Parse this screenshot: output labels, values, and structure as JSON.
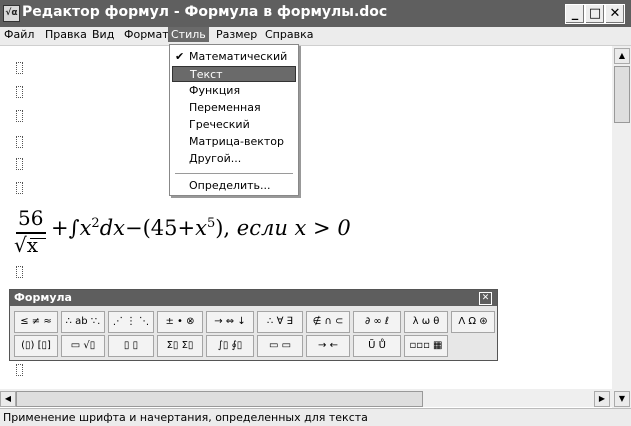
{
  "window": {
    "title": "Редактор формул - Формула в формулы.doc",
    "icon": "formula-editor-app-icon",
    "buttons": {
      "minimize": "_",
      "maximize": "□",
      "close": "✕"
    }
  },
  "menubar": {
    "items": [
      "Файл",
      "Правка",
      "Вид",
      "Формат",
      "Стиль",
      "Размер",
      "Справка"
    ],
    "active": "Стиль"
  },
  "style_menu": {
    "items": [
      {
        "label": "Математический",
        "checked": "✔"
      },
      {
        "label": "Текст"
      },
      {
        "label": "Функция"
      },
      {
        "label": "Переменная"
      },
      {
        "label": "Греческий"
      },
      {
        "label": "Матрица-вектор"
      },
      {
        "label": "Другой..."
      },
      {
        "label": "Определить..."
      }
    ],
    "highlighted": "Текст"
  },
  "equation": {
    "numerator": "56",
    "denominator": "√x",
    "main": {
      "a": "+",
      "b": "∫",
      "c": "x",
      "d": "2",
      "e": "dx",
      "f": "−(45+",
      "g": "x",
      "h": "5",
      "i": "), ",
      "j": "если",
      "k": "  x > 0"
    }
  },
  "palette": {
    "title": "Формула",
    "close": "✕",
    "row1": [
      "≤ ≠ ≈",
      "∴ ab ∵.",
      "⋰ ⋮ ⋱",
      "± • ⊗",
      "→ ⇔ ↓",
      "∴ ∀ ∃",
      "∉ ∩ ⊂",
      "∂ ∞ ℓ",
      "λ ω θ",
      "Λ Ω ⊛"
    ],
    "row2": [
      "(▯) [▯]",
      "▭ √▯",
      "▯ ▯",
      "Σ▯ Σ▯",
      "∫▯ ∮▯",
      "▭ ▭",
      "→ ←",
      "Ũ Ů",
      "▫▫▫ ▦"
    ]
  },
  "scrollbars": {
    "up": "▲",
    "down": "▼",
    "left": "◀",
    "right": "▶"
  },
  "status": "Применение шрифта и начертания, определенных для текста"
}
